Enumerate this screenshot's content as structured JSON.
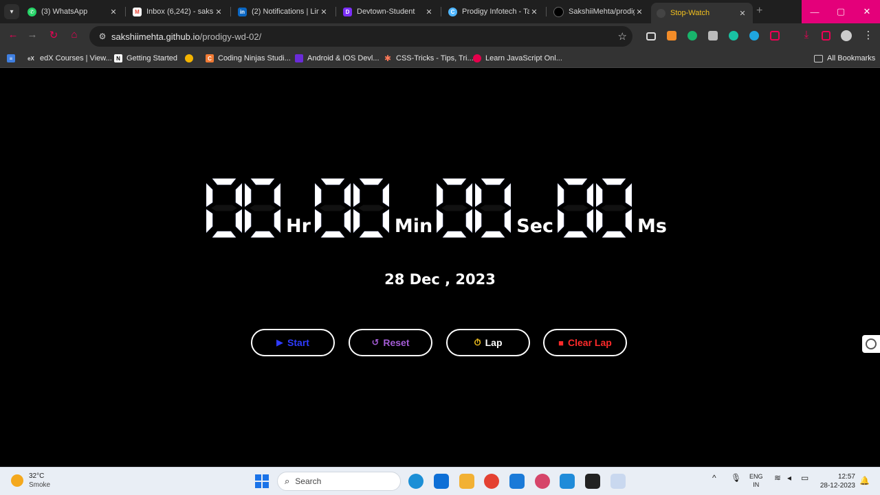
{
  "browser": {
    "tabs": [
      {
        "title": "(3) WhatsApp",
        "icon": "whatsapp-icon",
        "color": "#25d366"
      },
      {
        "title": "Inbox (6,242) - saksh",
        "icon": "gmail-icon",
        "color": "#ea4335"
      },
      {
        "title": "(2) Notifications | Lin",
        "icon": "linkedin-icon",
        "color": "#0a66c2"
      },
      {
        "title": "Devtown-Student",
        "icon": "devtown-icon",
        "color": "#7b2ff7"
      },
      {
        "title": "Prodigy Infotech - Ta",
        "icon": "prodigy-icon",
        "color": "#4fb6ff"
      },
      {
        "title": "SakshiiMehta/prodig",
        "icon": "github-icon",
        "color": "#000000"
      },
      {
        "title": "Stop-Watch",
        "icon": "page-icon",
        "color": "#444444"
      }
    ],
    "active_tab_title_color": "#f4c21f",
    "url_host": "sakshiimehta.github.io",
    "url_path": "/prodigy-wd-02/"
  },
  "bookmarks": [
    {
      "label": "edX Courses | View...",
      "icon": "edx-icon"
    },
    {
      "label": "Getting Started",
      "icon": "notion-icon"
    },
    {
      "label": "",
      "icon": "pinwheel-icon"
    },
    {
      "label": "Coding Ninjas Studi...",
      "icon": "coding-ninjas-icon"
    },
    {
      "label": "Android & IOS Devl...",
      "icon": "android-ios-icon"
    },
    {
      "label": "CSS-Tricks - Tips, Tri...",
      "icon": "css-tricks-icon"
    },
    {
      "label": "Learn JavaScript Onl...",
      "icon": "scrimba-icon"
    }
  ],
  "all_bookmarks_label": "All Bookmarks",
  "stopwatch": {
    "hours": "00",
    "hours_unit": "Hr",
    "minutes": "00",
    "minutes_unit": "Min",
    "seconds": "00",
    "seconds_unit": "Sec",
    "millis": "00",
    "millis_unit": "Ms",
    "date": "28 Dec , 2023",
    "buttons": {
      "start": {
        "label": "Start",
        "color": "#2f3cff"
      },
      "reset": {
        "label": "Reset",
        "color": "#a45cd6"
      },
      "lap": {
        "label": "Lap",
        "color": "#ffffff"
      },
      "clear_lap": {
        "label": "Clear Lap",
        "color": "#ff2a2a"
      }
    }
  },
  "taskbar": {
    "weather_temp": "32°C",
    "weather_desc": "Smoke",
    "search_placeholder": "Search",
    "lang_top": "ENG",
    "lang_bottom": "IN",
    "time": "12:57",
    "date": "28-12-2023"
  }
}
